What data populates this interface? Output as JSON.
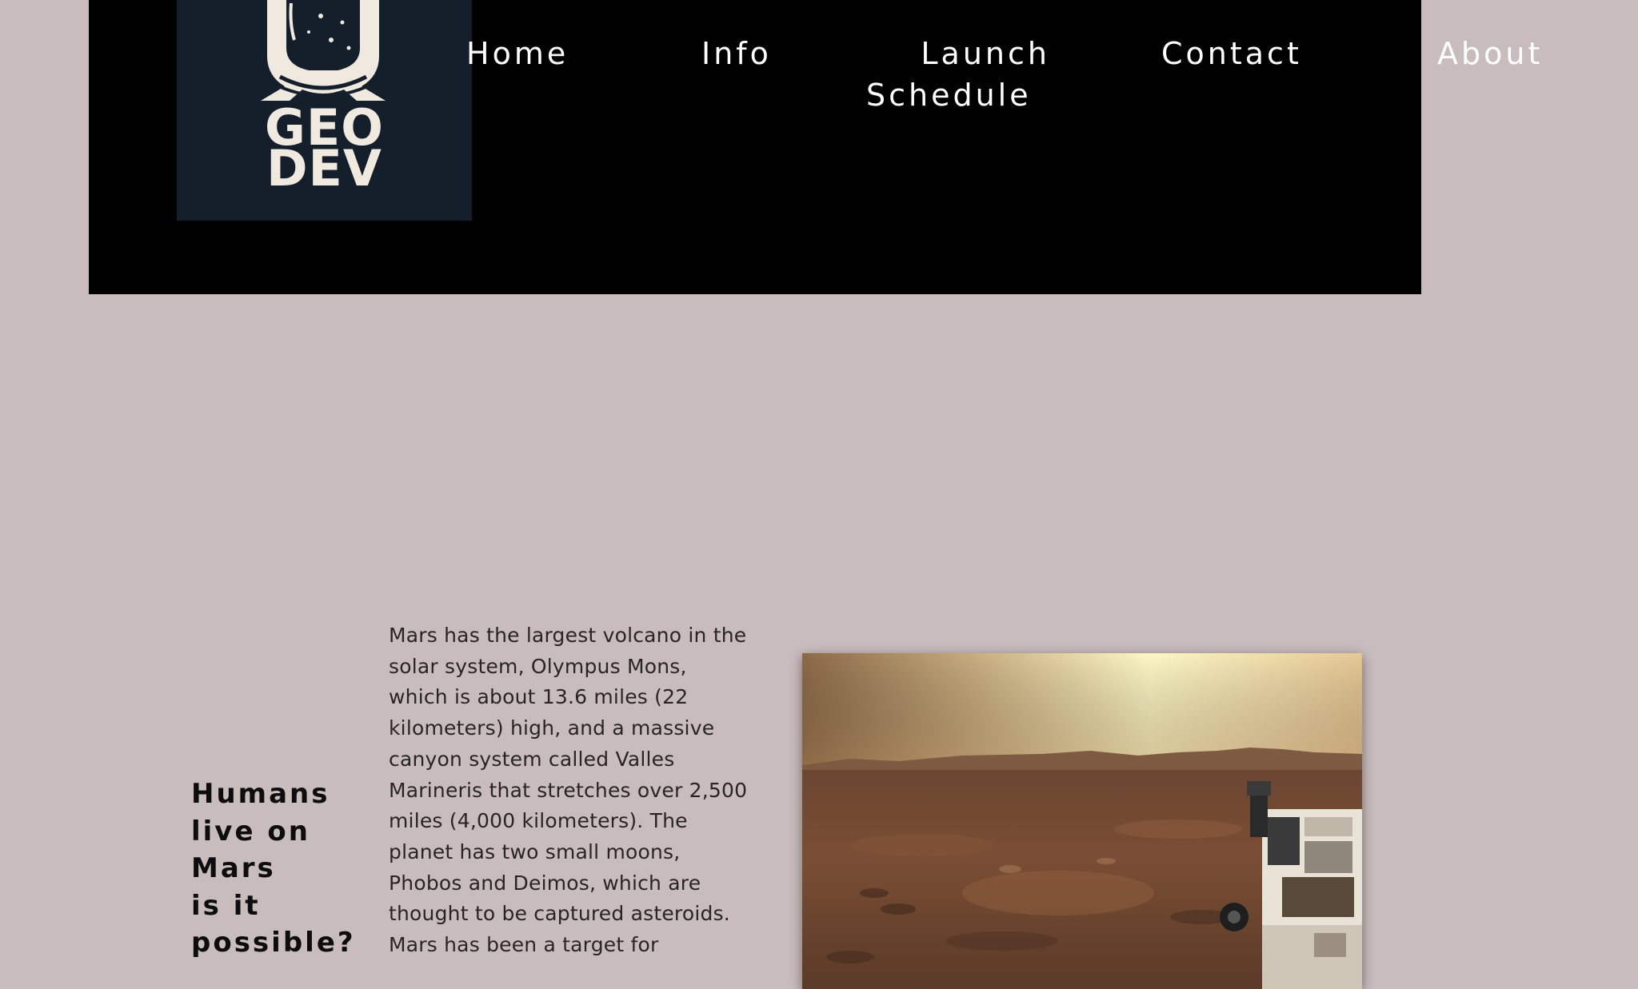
{
  "header": {
    "logo": {
      "line1": "GEO",
      "line2": "DEV",
      "icon": "astronaut-helmet-icon"
    },
    "nav": [
      {
        "label": "Home"
      },
      {
        "label": "Info"
      },
      {
        "label_line1": "Launch",
        "label_line2": "Schedule"
      },
      {
        "label": "Contact"
      },
      {
        "label": "About"
      }
    ]
  },
  "main": {
    "heading_lines": [
      "Humans",
      "live on",
      "Mars",
      "is it",
      "possible?"
    ],
    "article_text": "Mars has the largest volcano in the solar system, Olympus Mons, which is about 13.6 miles (22 kilometers) high, and a massive canyon system called Valles Marineris that stretches over 2,500 miles (4,000 kilometers). The planet has two small moons, Phobos and Deimos, which are thought to be captured asteroids. Mars has been a target for",
    "image": {
      "subject": "mars-surface-rover-photo"
    }
  },
  "colors": {
    "page_background": "#c9bcbc",
    "header_background": "#000000",
    "logo_background": "#151f2c",
    "logo_foreground": "#efe9df",
    "nav_text": "#ffffff",
    "body_text": "#2b2424"
  }
}
